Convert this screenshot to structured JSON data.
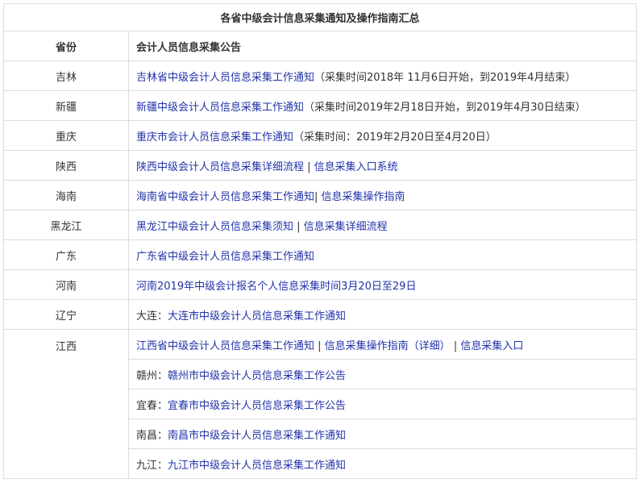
{
  "table": {
    "title": "各省中级会计信息采集通知及操作指南汇总",
    "headers": [
      "省份",
      "会计人员信息采集公告"
    ],
    "rows": [
      {
        "province": "吉林",
        "parts": [
          {
            "text": "吉林省中级会计人员信息采集工作通知",
            "link": true
          },
          {
            "text": "（采集时间2018年 11月6日开始，到2019年4月结束）",
            "link": false
          }
        ]
      },
      {
        "province": "新疆",
        "parts": [
          {
            "text": "新疆中级会计人员信息采集工作通知",
            "link": true
          },
          {
            "text": "（采集时间2019年2月18日开始，到2019年4月30日结束）",
            "link": false
          }
        ]
      },
      {
        "province": "重庆",
        "parts": [
          {
            "text": "重庆市会计人员信息采集工作通知",
            "link": true
          },
          {
            "text": "（采集时间：2019年2月20日至4月20日）",
            "link": false
          }
        ]
      },
      {
        "province": "陕西",
        "parts": [
          {
            "text": "陕西中级会计人员信息采集详细流程",
            "link": true
          },
          {
            "text": " | ",
            "link": false
          },
          {
            "text": "信息采集入口系统",
            "link": true
          }
        ]
      },
      {
        "province": "海南",
        "parts": [
          {
            "text": "海南省中级会计人员信息采集工作通知",
            "link": true
          },
          {
            "text": "| ",
            "link": false
          },
          {
            "text": "信息采集操作指南",
            "link": true
          }
        ]
      },
      {
        "province": "黑龙江",
        "parts": [
          {
            "text": "黑龙江中级会计人员信息采集须知",
            "link": true
          },
          {
            "text": " | ",
            "link": false
          },
          {
            "text": "信息采集详细流程",
            "link": true
          }
        ]
      },
      {
        "province": "广东",
        "parts": [
          {
            "text": "广东省中级会计人员信息采集工作通知",
            "link": true
          }
        ]
      },
      {
        "province": "河南",
        "parts": [
          {
            "text": "河南2019年中级会计报名个人信息采集时间3月20日至29日",
            "link": true
          }
        ]
      },
      {
        "province": "辽宁",
        "parts": [
          {
            "text": "大连：",
            "link": false
          },
          {
            "text": "大连市中级会计人员信息采集工作通知",
            "link": true
          }
        ]
      }
    ],
    "jiangxi": {
      "province": "江西",
      "rows": [
        {
          "parts": [
            {
              "text": "江西省中级会计人员信息采集工作通知",
              "link": true
            },
            {
              "text": " | ",
              "link": false
            },
            {
              "text": "信息采集操作指南（详细）",
              "link": true
            },
            {
              "text": " | ",
              "link": false
            },
            {
              "text": "信息采集入口",
              "link": true
            }
          ]
        },
        {
          "parts": [
            {
              "text": "赣州：",
              "link": false
            },
            {
              "text": "赣州市中级会计人员信息采集工作公告",
              "link": true
            }
          ]
        },
        {
          "parts": [
            {
              "text": "宜春：",
              "link": false
            },
            {
              "text": "宜春市中级会计人员信息采集工作公告",
              "link": true
            }
          ]
        },
        {
          "parts": [
            {
              "text": "南昌：",
              "link": false
            },
            {
              "text": "南昌市中级会计人员信息采集工作通知",
              "link": true
            }
          ]
        },
        {
          "parts": [
            {
              "text": "九江：",
              "link": false
            },
            {
              "text": "九江市中级会计人员信息采集工作通知",
              "link": true
            }
          ]
        }
      ]
    }
  }
}
